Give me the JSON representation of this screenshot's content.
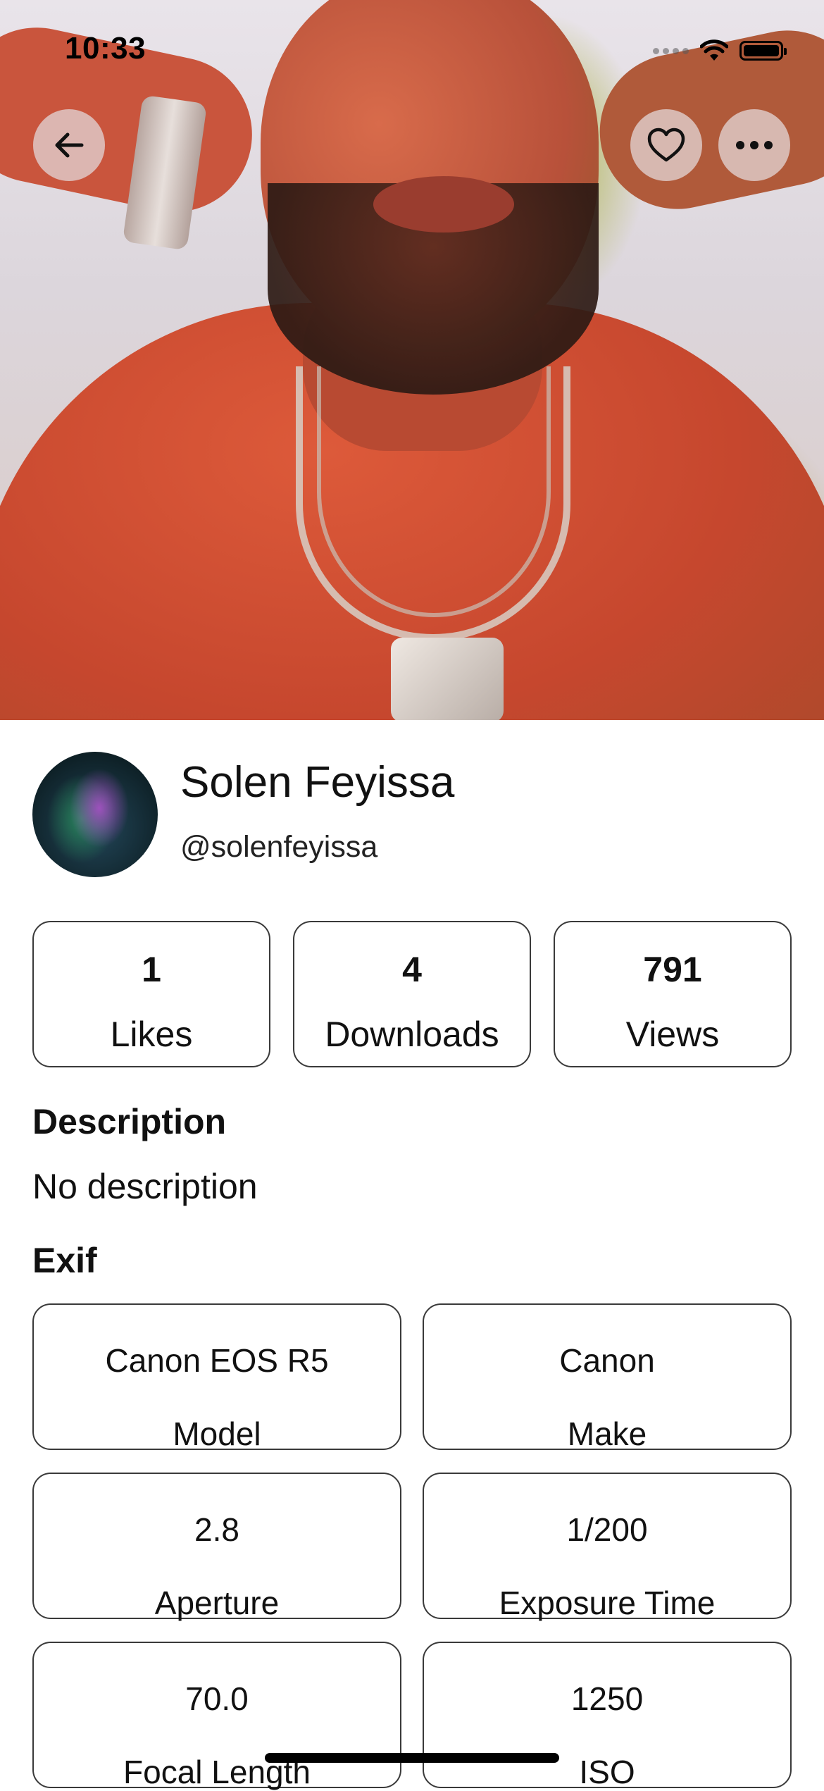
{
  "status_bar": {
    "time": "10:33"
  },
  "nav": {
    "back_icon": "arrow-left-icon",
    "like_icon": "heart-outline-icon",
    "more_icon": "ellipsis-icon"
  },
  "photo": {
    "description_icon": "photo"
  },
  "author": {
    "name": "Solen Feyissa",
    "username": "@solenfeyissa"
  },
  "stats": [
    {
      "value": "1",
      "label": "Likes"
    },
    {
      "value": "4",
      "label": "Downloads"
    },
    {
      "value": "791",
      "label": "Views"
    }
  ],
  "description": {
    "title": "Description",
    "text": "No description"
  },
  "exif": {
    "title": "Exif",
    "items": [
      {
        "value": "Canon EOS R5",
        "label": "Model"
      },
      {
        "value": "Canon",
        "label": "Make"
      },
      {
        "value": "2.8",
        "label": "Aperture"
      },
      {
        "value": "1/200",
        "label": "Exposure Time"
      },
      {
        "value": "70.0",
        "label": "Focal Length"
      },
      {
        "value": "1250",
        "label": "ISO"
      }
    ]
  },
  "colors": {
    "card_border": "#3a3a3a",
    "text": "#111111",
    "button_bg": "#e1d2d2"
  }
}
